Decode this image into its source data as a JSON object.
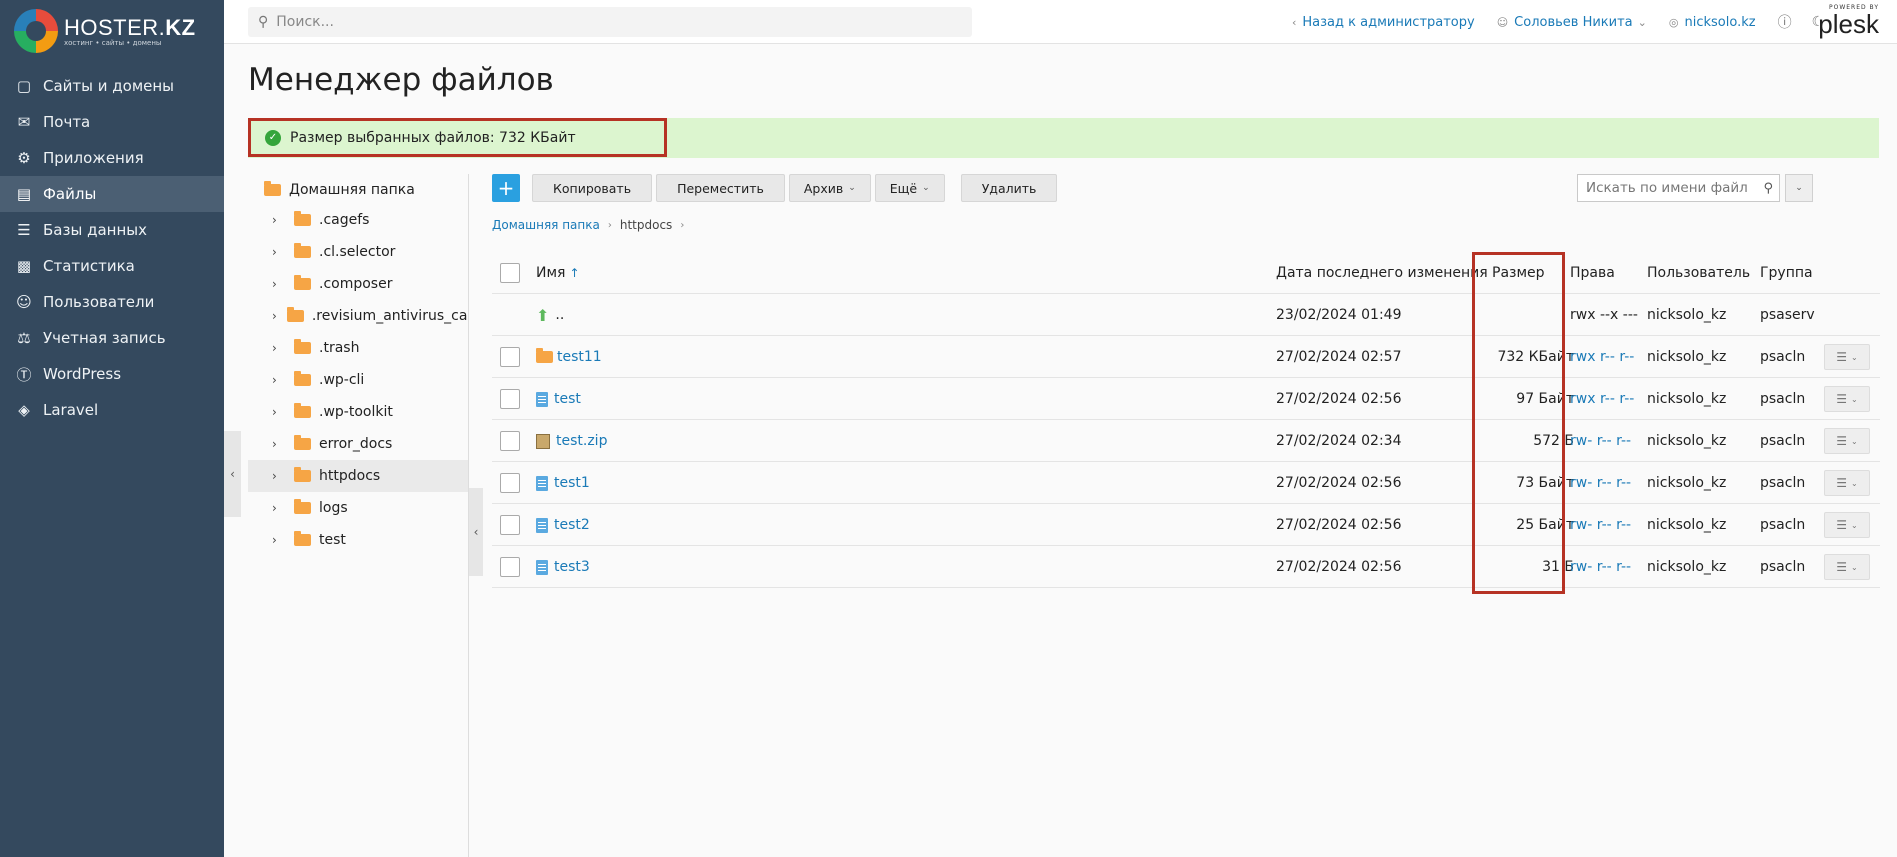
{
  "brand": {
    "name_light": "HOSTER.",
    "name_bold": "KZ",
    "tagline": "хостинг • сайты • домены"
  },
  "sidebar": {
    "items": [
      {
        "label": "Сайты и домены",
        "icon": "monitor-icon"
      },
      {
        "label": "Почта",
        "icon": "mail-icon"
      },
      {
        "label": "Приложения",
        "icon": "gear-icon"
      },
      {
        "label": "Файлы",
        "icon": "files-icon",
        "active": true
      },
      {
        "label": "Базы данных",
        "icon": "database-icon"
      },
      {
        "label": "Статистика",
        "icon": "chart-icon"
      },
      {
        "label": "Пользователи",
        "icon": "user-icon"
      },
      {
        "label": "Учетная запись",
        "icon": "account-icon"
      },
      {
        "label": "WordPress",
        "icon": "wordpress-icon"
      },
      {
        "label": "Laravel",
        "icon": "laravel-icon"
      }
    ]
  },
  "topbar": {
    "search_placeholder": "Поиск...",
    "back_label": "Назад к администратору",
    "user_label": "Соловьев Никита",
    "domain_label": "nicksolo.kz",
    "powered_by": "POWERED BY",
    "plesk": "plesk"
  },
  "page": {
    "title": "Менеджер файлов"
  },
  "notice": {
    "text": "Размер выбранных файлов: 732 КБайт",
    "color": "#dcf5cf",
    "highlight": "#b63224"
  },
  "tree": {
    "root": "Домашняя папка",
    "items": [
      ".cagefs",
      ".cl.selector",
      ".composer",
      ".revisium_antivirus_cach",
      ".trash",
      ".wp-cli",
      ".wp-toolkit",
      "error_docs",
      "httpdocs",
      "logs",
      "test"
    ],
    "selected": "httpdocs"
  },
  "toolbar": {
    "add": "+",
    "copy": "Копировать",
    "move": "Переместить",
    "archive": "Архив",
    "more": "Ещё",
    "delete": "Удалить",
    "search_placeholder": "Искать по имени файла"
  },
  "breadcrumb": {
    "home": "Домашняя папка",
    "current": "httpdocs"
  },
  "table": {
    "headers": {
      "name": "Имя",
      "sort": "↑",
      "date": "Дата последнего изменения",
      "size": "Размер",
      "perms": "Права",
      "user": "Пользователь",
      "group": "Группа"
    },
    "rows": [
      {
        "name": "..",
        "type": "up",
        "date": "23/02/2024 01:49",
        "size": "",
        "perms": "rwx --x ---",
        "user": "nicksolo_kz",
        "group": "psaserv"
      },
      {
        "name": "test11",
        "type": "folder",
        "date": "27/02/2024 02:57",
        "size": "732 КБайт",
        "perms": "rwx r-- r--",
        "user": "nicksolo_kz",
        "group": "psacln"
      },
      {
        "name": "test",
        "type": "file",
        "date": "27/02/2024 02:56",
        "size": "97 Байт",
        "perms": "rwx r-- r--",
        "user": "nicksolo_kz",
        "group": "psacln"
      },
      {
        "name": "test.zip",
        "type": "zip",
        "date": "27/02/2024 02:34",
        "size": "572 Б",
        "perms": "rw- r-- r--",
        "user": "nicksolo_kz",
        "group": "psacln"
      },
      {
        "name": "test1",
        "type": "file",
        "date": "27/02/2024 02:56",
        "size": "73 Байт",
        "perms": "rw- r-- r--",
        "user": "nicksolo_kz",
        "group": "psacln"
      },
      {
        "name": "test2",
        "type": "file",
        "date": "27/02/2024 02:56",
        "size": "25 Байт",
        "perms": "rw- r-- r--",
        "user": "nicksolo_kz",
        "group": "psacln"
      },
      {
        "name": "test3",
        "type": "file",
        "date": "27/02/2024 02:56",
        "size": "31 Б",
        "perms": "rw- r-- r--",
        "user": "nicksolo_kz",
        "group": "psacln"
      }
    ]
  },
  "colors": {
    "sidebar": "#34495e",
    "accent": "#1a7ab7",
    "add_button": "#2aa0e0"
  }
}
